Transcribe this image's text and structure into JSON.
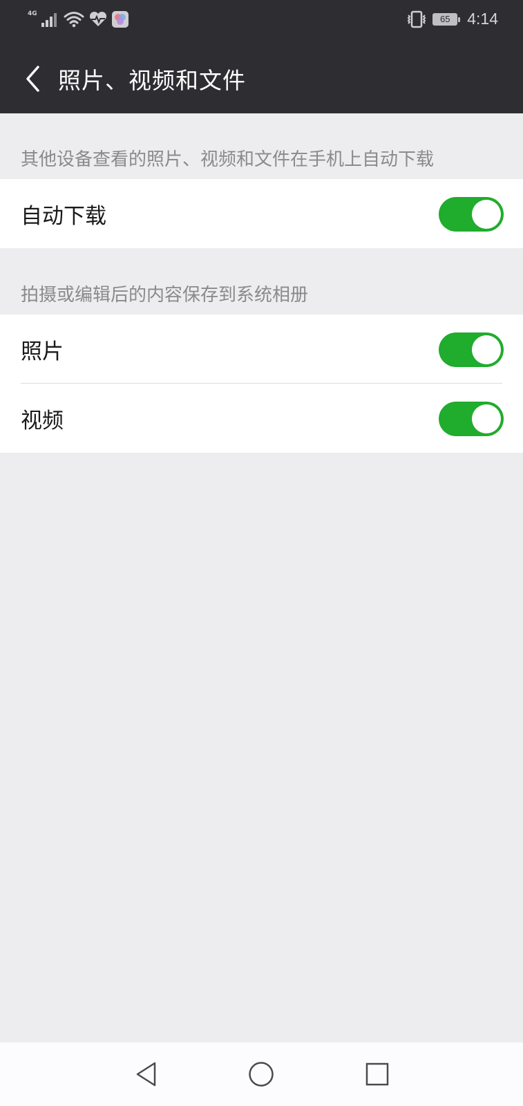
{
  "status_bar": {
    "network_label": "4G",
    "battery_level": "65",
    "time": "4:14"
  },
  "header": {
    "title": "照片、视频和文件"
  },
  "sections": [
    {
      "header": "其他设备查看的照片、视频和文件在手机上自动下载",
      "items": [
        {
          "label": "自动下载",
          "enabled": true
        }
      ]
    },
    {
      "header": "拍摄或编辑后的内容保存到系统相册",
      "items": [
        {
          "label": "照片",
          "enabled": true
        },
        {
          "label": "视频",
          "enabled": true
        }
      ]
    }
  ],
  "colors": {
    "toggle_on": "#20AC2D",
    "nav_background": "#2E2D31",
    "page_background": "#EDECEE"
  },
  "icons": {
    "back": "chevron-left-icon",
    "signal": "signal-icon",
    "wifi": "wifi-icon",
    "health": "heart-pulse-icon",
    "app": "app-badge-icon",
    "vibrate": "vibrate-icon",
    "nav_back": "triangle-back-icon",
    "nav_home": "circle-home-icon",
    "nav_recent": "square-recent-icon"
  }
}
